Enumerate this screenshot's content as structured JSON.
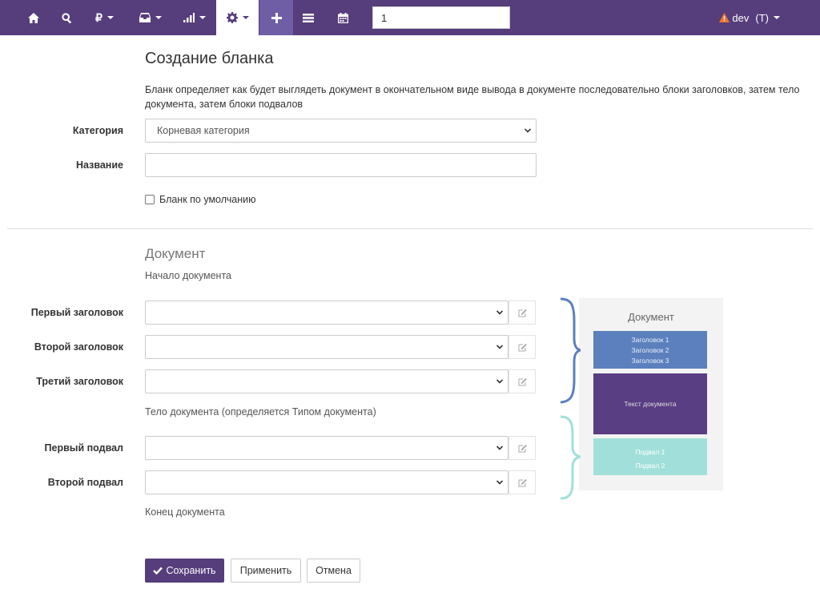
{
  "navbar": {
    "icons": [
      "home-icon",
      "search-icon",
      "ruble-icon",
      "inbox-icon",
      "signal-icon",
      "gear-icon",
      "plus-icon",
      "list-icon",
      "calendar-icon"
    ],
    "search_value": "1",
    "user_name": "dev",
    "user_suffix": "(T)",
    "colors": {
      "bg": "#563d7c",
      "active": "#ffffff",
      "plus_bg": "#6f5da6",
      "warning": "#f0732b"
    }
  },
  "page": {
    "title": "Создание бланка",
    "description": "Бланк определяет как будет выглядеть документ в окончательном виде вывода в документе последовательно блоки заголовков, затем тело документа, затем блоки подвалов"
  },
  "form": {
    "category_label": "Категория",
    "category_value": "Корневая категория",
    "name_label": "Название",
    "name_value": "",
    "default_checkbox_label": "Бланк по умолчанию",
    "default_checked": false
  },
  "document": {
    "section_title": "Документ",
    "start_hint": "Начало документа",
    "header1_label": "Первый заголовок",
    "header2_label": "Второй заголовок",
    "header3_label": "Третий заголовок",
    "body_hint": "Тело документа (определяется Типом документа)",
    "footer1_label": "Первый подвал",
    "footer2_label": "Второй подвал",
    "end_hint": "Конец документа"
  },
  "diagram": {
    "title": "Документ",
    "headers": [
      "Заголовок 1",
      "Заголовок 2",
      "Заголовок 3"
    ],
    "body": "Текст документа",
    "footers": [
      "Подвал 1",
      "Подвал 2"
    ],
    "colors": {
      "headers": "#5b80bd",
      "body": "#5a3e84",
      "footers": "#a1e0da",
      "header_brace": "#5b80bd",
      "footer_brace": "#a1e0da"
    }
  },
  "actions": {
    "save_label": "Сохранить",
    "apply_label": "Применить",
    "cancel_label": "Отмена"
  }
}
